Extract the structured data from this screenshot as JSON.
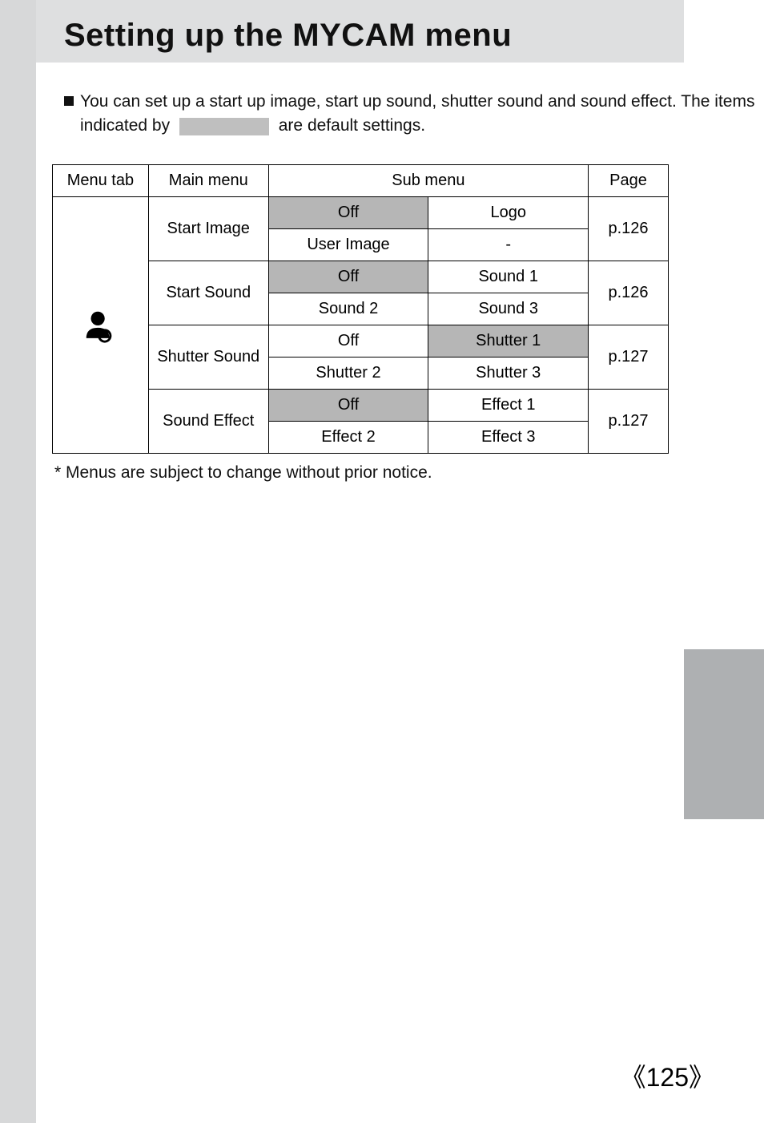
{
  "title": "Setting up the MYCAM menu",
  "intro": {
    "line1_prefix": "You can set up a start up image, start up sound, shutter sound and sound effect. The items",
    "line2_prefix": "indicated by ",
    "line2_suffix": " are default settings."
  },
  "table": {
    "headers": {
      "menu_tab": "Menu tab",
      "main_menu": "Main menu",
      "sub_menu": "Sub menu",
      "page": "Page"
    },
    "rows": {
      "start_image": {
        "label": "Start Image",
        "cells": {
          "a": "Off",
          "b": "Logo",
          "c": "User Image",
          "d": "-"
        },
        "page": "p.126"
      },
      "start_sound": {
        "label": "Start Sound",
        "cells": {
          "a": "Off",
          "b": "Sound 1",
          "c": "Sound 2",
          "d": "Sound 3"
        },
        "page": "p.126"
      },
      "shutter_sound": {
        "label": "Shutter Sound",
        "cells": {
          "a": "Off",
          "b": "Shutter 1",
          "c": "Shutter 2",
          "d": "Shutter 3"
        },
        "page": "p.127"
      },
      "sound_effect": {
        "label": "Sound Effect",
        "cells": {
          "a": "Off",
          "b": "Effect 1",
          "c": "Effect 2",
          "d": "Effect 3"
        },
        "page": "p.127"
      }
    }
  },
  "footnote": "* Menus are subject to change without prior notice.",
  "page_number": "125"
}
